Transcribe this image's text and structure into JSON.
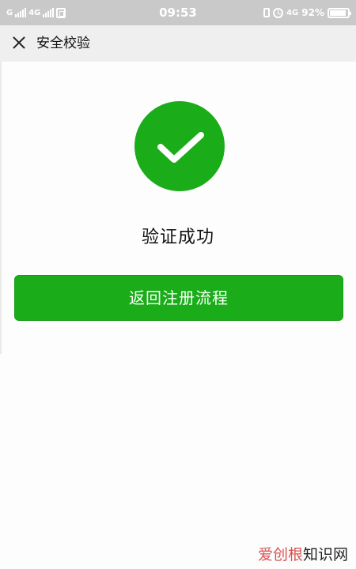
{
  "status_bar": {
    "network_1": "G",
    "network_2": "4G",
    "time": "09:53",
    "network_right": "4G",
    "battery_percent": "92%",
    "battery_level": 0.92
  },
  "nav": {
    "title": "安全校验",
    "close_icon": "close-icon"
  },
  "result": {
    "icon": "checkmark-icon",
    "message": "验证成功",
    "accent_color": "#1aad19"
  },
  "actions": {
    "return_label": "返回注册流程"
  },
  "watermark": {
    "accent": "爱创根",
    "rest": "知识网"
  }
}
